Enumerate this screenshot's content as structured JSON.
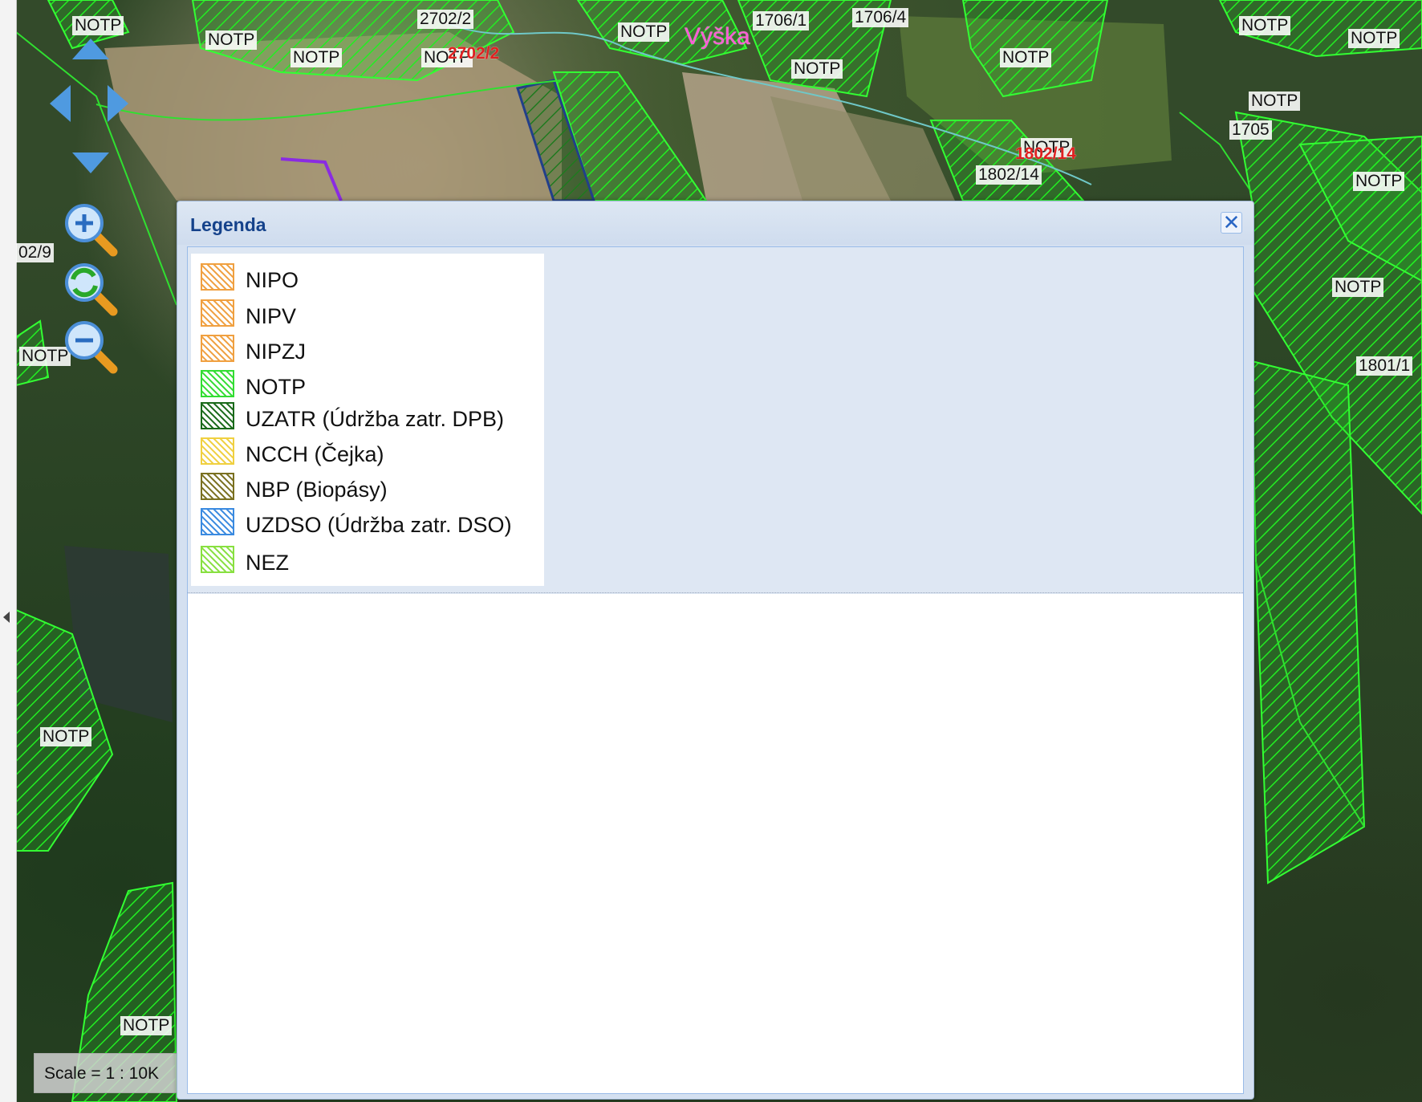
{
  "map": {
    "labels": [
      {
        "id": "l1",
        "text": "NOTP"
      },
      {
        "id": "l2",
        "text": "NOTP"
      },
      {
        "id": "l3",
        "text": "NOTP"
      },
      {
        "id": "l4",
        "text": "2702/2"
      },
      {
        "id": "l5",
        "text": "NOTP"
      },
      {
        "id": "l6",
        "text": "2702/2"
      },
      {
        "id": "l7",
        "text": "NOTP"
      },
      {
        "id": "l8",
        "text": "1706/1"
      },
      {
        "id": "l9",
        "text": "1706/4"
      },
      {
        "id": "l10",
        "text": "NOTP"
      },
      {
        "id": "l11",
        "text": "NOTP"
      },
      {
        "id": "l12",
        "text": "NOTP"
      },
      {
        "id": "l13",
        "text": "NOTP"
      },
      {
        "id": "l14",
        "text": "NOTP"
      },
      {
        "id": "l15",
        "text": "1705"
      },
      {
        "id": "l16",
        "text": "NOTP"
      },
      {
        "id": "l17",
        "text": "1802/14"
      },
      {
        "id": "l18",
        "text": "1802/14"
      },
      {
        "id": "l19",
        "text": "NOTP"
      },
      {
        "id": "l20",
        "text": "NOTP"
      },
      {
        "id": "l21",
        "text": "1801/1"
      },
      {
        "id": "l22",
        "text": "02/9"
      },
      {
        "id": "l23",
        "text": "NOTP"
      },
      {
        "id": "l24",
        "text": "NOTP"
      },
      {
        "id": "l25",
        "text": "NOTP"
      },
      {
        "id": "l26",
        "text": "Výška"
      }
    ],
    "scale_text": "Scale = 1 : 10K"
  },
  "legend": {
    "title": "Legenda",
    "close_icon": "close-icon",
    "items": [
      {
        "label": "NIPO",
        "color": "#f0a040"
      },
      {
        "label": "NIPV",
        "color": "#f0a040"
      },
      {
        "label": "NIPZJ",
        "color": "#f0a040"
      },
      {
        "label": "NOTP",
        "color": "#33dd33"
      },
      {
        "label": "UZATR (Údržba zatr. DPB)",
        "color": "#1a6a1a"
      },
      {
        "label": "NCCH (Čejka)",
        "color": "#f0d040"
      },
      {
        "label": "NBP (Biopásy)",
        "color": "#7a7020"
      },
      {
        "label": "UZDSO (Údržba zatr. DSO)",
        "color": "#3a8ae0"
      },
      {
        "label": "NEZ",
        "color": "#88e040"
      }
    ]
  },
  "colors": {
    "notp_green": "#22ee22",
    "parcel_line": "#1aa84a",
    "legend_title": "#15428b",
    "nav_blue": "#4f9ae0"
  }
}
